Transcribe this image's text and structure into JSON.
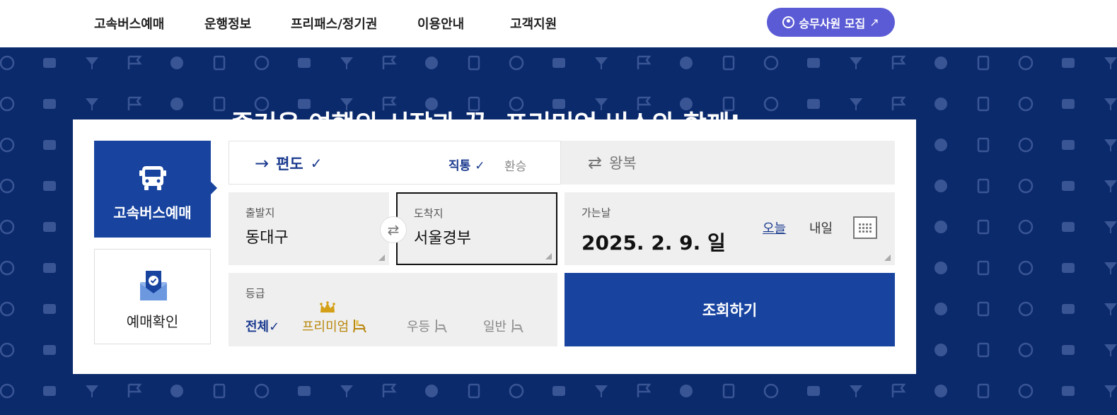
{
  "nav": {
    "items": [
      "고속버스예매",
      "운행정보",
      "프리패스/정기권",
      "이용안내",
      "고객지원"
    ],
    "recruit_label": "승무사원 모집",
    "recruit_arrow": "↗"
  },
  "hero": {
    "headline": "즐거운 여행의 시작과 끝, 프리미엄 버스와 함께!"
  },
  "side_tabs": {
    "booking": "고속버스예매",
    "confirm": "예매확인"
  },
  "trip": {
    "oneway_arrow": "→",
    "oneway": "편도",
    "oneway_check": "✓",
    "direct": "직통 ✓",
    "transfer": "환승",
    "roundtrip_arrow": "⇄",
    "roundtrip": "왕복"
  },
  "route": {
    "depart_caption": "출발지",
    "depart_value": "동대구",
    "arrive_caption": "도착지",
    "arrive_value": "서울경부",
    "swap_symbol": "⇄"
  },
  "date": {
    "caption": "가는날",
    "value": "2025. 2. 9. 일",
    "today": "오늘",
    "tomorrow": "내일"
  },
  "grade": {
    "caption": "등급",
    "all": "전체✓",
    "premium": "프리미엄",
    "excellent": "우등",
    "normal": "일반"
  },
  "search_label": "조회하기",
  "colors": {
    "hero_bg": "#0b2a6b",
    "primary": "#1844a0",
    "recruit": "#5b5bd6",
    "premium_gold": "#b8860b"
  }
}
